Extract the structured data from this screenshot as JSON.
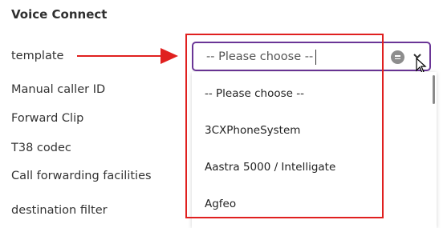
{
  "section": {
    "title": "Voice Connect"
  },
  "labels": {
    "template": "template",
    "manual_caller_id": "Manual caller ID",
    "forward_clip": "Forward Clip",
    "t38_codec": "T38 codec",
    "call_forwarding": "Call forwarding facilities",
    "destination_filter": "destination filter"
  },
  "template_select": {
    "value": "-- Please choose --",
    "options": [
      "-- Please choose --",
      "3CXPhoneSystem",
      "Aastra 5000 / Intelligate",
      "Agfeo"
    ]
  },
  "icons": {
    "clear": "clear-icon",
    "chevron": "chevron-down-icon",
    "cursor": "mouse-cursor-icon",
    "arrow": "arrow-right-icon"
  },
  "colors": {
    "focus_border": "#6a3596",
    "annotation_red": "#e0201f"
  }
}
